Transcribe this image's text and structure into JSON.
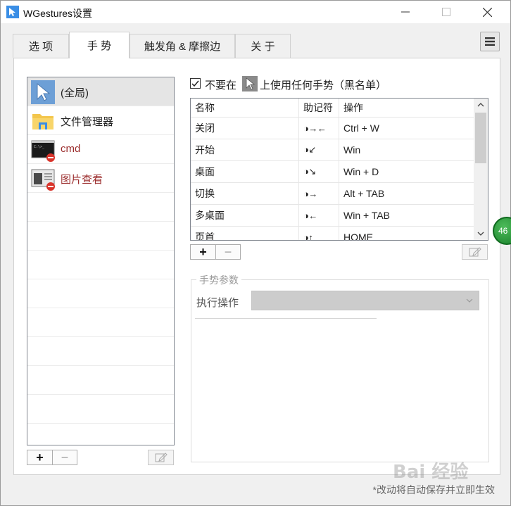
{
  "window": {
    "title": "WGestures设置",
    "controls": {
      "minimize": "—",
      "maximize": "☐",
      "close": "✕"
    }
  },
  "tabs": [
    {
      "label": "选 项",
      "active": false
    },
    {
      "label": "手 势",
      "active": true
    },
    {
      "label": "触发角 & 摩擦边",
      "active": false
    },
    {
      "label": "关 于",
      "active": false
    }
  ],
  "menu_button_icon": "hamburger-menu-icon",
  "app_list": {
    "items": [
      {
        "label": "(全局)",
        "icon": "cursor-arrow-icon",
        "selected": true,
        "disabled": false
      },
      {
        "label": "文件管理器",
        "icon": "folder-icon",
        "selected": false,
        "disabled": false
      },
      {
        "label": "cmd",
        "icon": "terminal-icon",
        "selected": false,
        "disabled": true
      },
      {
        "label": "图片查看",
        "icon": "photo-viewer-icon",
        "selected": false,
        "disabled": true
      }
    ],
    "add_label": "+",
    "remove_label": "−"
  },
  "blacklist": {
    "checked": true,
    "text_before": "不要在",
    "text_after": "上使用任何手势（黑名单）"
  },
  "gestures": {
    "columns": [
      "名称",
      "助记符",
      "操作"
    ],
    "rows": [
      {
        "name": "关闭",
        "mnemonic": "◑→←",
        "action": "Ctrl + W"
      },
      {
        "name": "开始",
        "mnemonic": "◑↙",
        "action": "Win"
      },
      {
        "name": "桌面",
        "mnemonic": "◑↘",
        "action": "Win + D"
      },
      {
        "name": "切换",
        "mnemonic": "◑→",
        "action": "Alt + TAB"
      },
      {
        "name": "多桌面",
        "mnemonic": "◑←",
        "action": "Win + TAB"
      },
      {
        "name": "页首",
        "mnemonic": "◑↑",
        "action": "HOME"
      }
    ],
    "add_label": "+",
    "remove_label": "−"
  },
  "params": {
    "legend": "手势参数",
    "action_label": "执行操作",
    "action_value": ""
  },
  "footer": "*改动将自动保存并立即生效",
  "overlay": {
    "badge": "46",
    "watermark": "Bai 经验"
  },
  "colors": {
    "disabled_red": "#9b2c2c",
    "selection": "#e5e5e5",
    "badge_green": "#18802a"
  }
}
